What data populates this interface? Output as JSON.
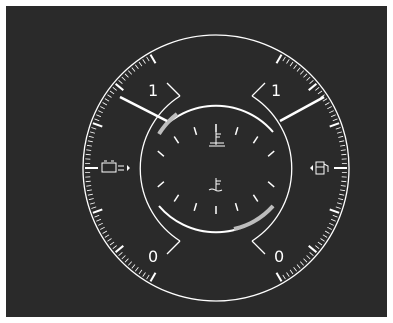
{
  "colors": {
    "background": "#2a2a2a",
    "frame": "#ffffff",
    "ticks": "#ffffff",
    "accent": "#bdbdbd"
  },
  "left_gauge": {
    "name": "battery",
    "icon": "battery-icon",
    "top_label": "1",
    "bottom_label": "0"
  },
  "right_gauge": {
    "name": "fuel",
    "icon": "fuel-pump-icon",
    "top_label": "1",
    "bottom_label": "0"
  },
  "upper_center_gauge": {
    "name": "oil-temperature",
    "icon": "oil-temp-icon"
  },
  "lower_center_gauge": {
    "name": "coolant-temperature",
    "icon": "coolant-temp-icon"
  }
}
